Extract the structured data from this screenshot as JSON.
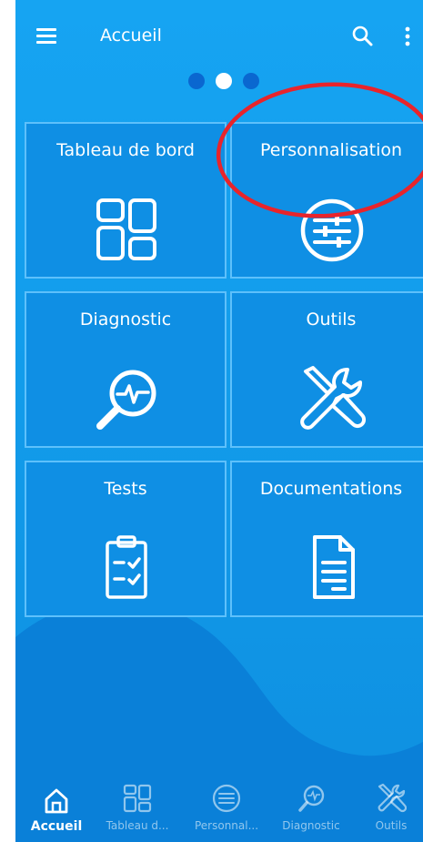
{
  "app_bar": {
    "title": "Accueil",
    "menu_icon": "hamburger-menu-icon",
    "search_icon": "search-icon",
    "more_icon": "more-vert-icon"
  },
  "pager": {
    "page_count": 3,
    "active_page": 2
  },
  "tiles": [
    {
      "label": "Tableau de bord",
      "icon": "dashboard-icon"
    },
    {
      "label": "Personnalisation",
      "icon": "sliders-icon"
    },
    {
      "label": "Diagnostic",
      "icon": "magnifier-pulse-icon"
    },
    {
      "label": "Outils",
      "icon": "tools-icon"
    },
    {
      "label": "Tests",
      "icon": "clipboard-checklist-icon"
    },
    {
      "label": "Documentations",
      "icon": "document-icon"
    }
  ],
  "annotation": {
    "shape": "ellipse",
    "target": "Personnalisation",
    "color": "#e8242b"
  },
  "bottom_nav": [
    {
      "label": "Accueil",
      "icon": "home-icon",
      "active": true
    },
    {
      "label": "Tableau d...",
      "icon": "dashboard-icon",
      "active": false
    },
    {
      "label": "Personnal...",
      "icon": "sliders-icon",
      "active": false
    },
    {
      "label": "Diagnostic",
      "icon": "magnifier-pulse-icon",
      "active": false
    },
    {
      "label": "Outils",
      "icon": "tools-icon",
      "active": false
    }
  ],
  "colors": {
    "background": "#129ceb",
    "tile": "#0f8fe4",
    "tile_border": "#5ec0fb",
    "wave": "#0a80d8",
    "dot_inactive": "#0a67d0",
    "dot_active": "#ffffff"
  }
}
